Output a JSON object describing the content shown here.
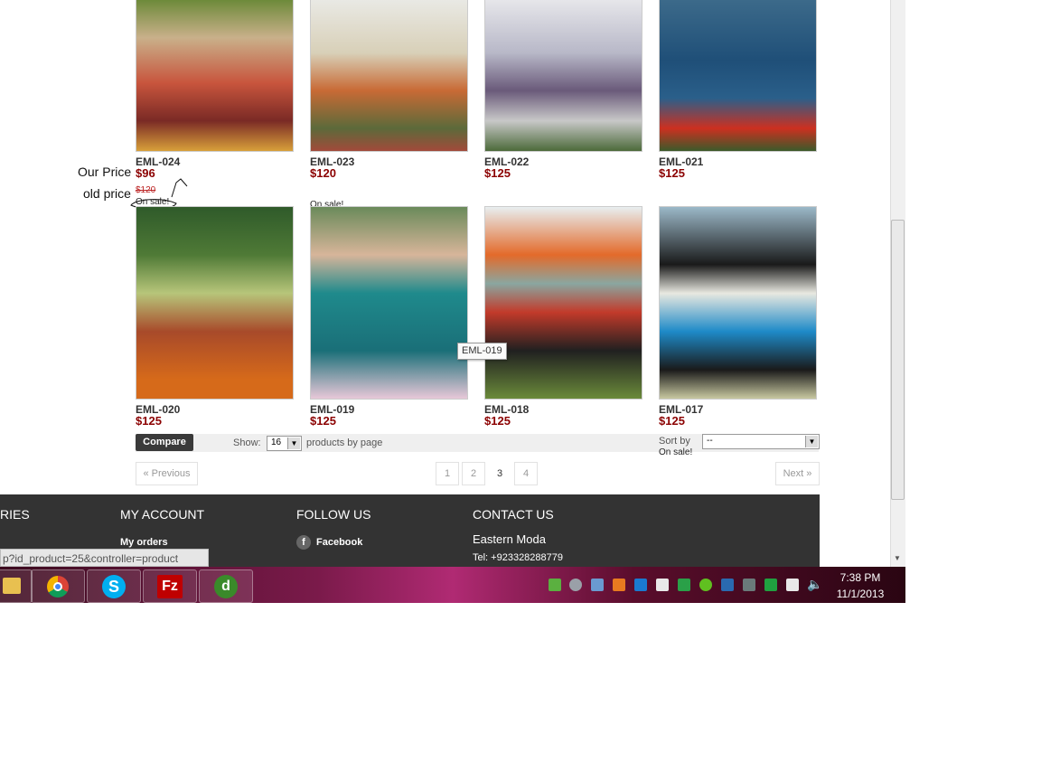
{
  "products_row1": [
    {
      "name": "EML-024",
      "price": "$96",
      "old_price": "$120",
      "on_sale": "On sale!"
    },
    {
      "name": "EML-023",
      "price": "$120",
      "on_sale": "On sale!"
    },
    {
      "name": "EML-022",
      "price": "$125"
    },
    {
      "name": "EML-021",
      "price": "$125"
    }
  ],
  "products_row2": [
    {
      "name": "EML-020",
      "price": "$125"
    },
    {
      "name": "EML-019",
      "price": "$125"
    },
    {
      "name": "EML-018",
      "price": "$125"
    },
    {
      "name": "EML-017",
      "price": "$125"
    }
  ],
  "tooltip": "EML-019",
  "annotations": {
    "our_price": "Our Price",
    "old_price": "old price"
  },
  "toolbar": {
    "compare_label": "Compare",
    "show_label": "Show:",
    "per_page_value": "16",
    "per_page_suffix": "products by page",
    "sort_label": "Sort by",
    "sort_value": "--",
    "sort_sub": "On sale!"
  },
  "pager": {
    "previous": "« Previous",
    "pages": [
      "1",
      "2",
      "3",
      "4"
    ],
    "current": "3",
    "next": "Next »"
  },
  "footer": {
    "col0_heading": "RIES",
    "account_heading": "MY ACCOUNT",
    "account_link": "My orders",
    "follow_heading": "FOLLOW US",
    "facebook": "Facebook",
    "contact_heading": "CONTACT US",
    "company": "Eastern Moda",
    "tel": "Tel: +923328288779"
  },
  "status_url": "p?id_product=25&controller=product",
  "taskbar": {
    "time": "7:38 PM",
    "date": "11/1/2013"
  },
  "colors": {
    "price": "#8b0000",
    "footer_bg": "#333333",
    "taskbar_accent": "#b02a73"
  }
}
